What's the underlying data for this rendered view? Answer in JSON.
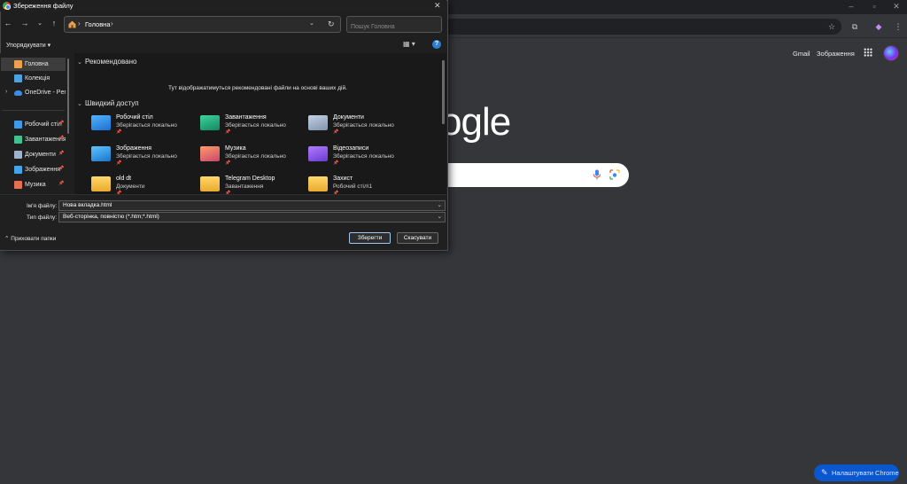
{
  "dialog": {
    "title": "Збереження файлу",
    "address": {
      "path": "Головна"
    },
    "search_placeholder": "Пошук Головна",
    "organize_label": "Упорядкувати ▾",
    "help_label": "?",
    "nav": [
      {
        "label": "Головна",
        "icon": "home-icon",
        "color": "#f0a04b"
      },
      {
        "label": "Колекція",
        "icon": "gallery-icon",
        "color": "#4aa3df"
      },
      {
        "label": "OneDrive - Pers",
        "icon": "cloud-icon",
        "color": "#3c8ce7"
      },
      {
        "label": "Робочий стіл",
        "icon": "desktop-icon",
        "color": "#3d9ae8"
      },
      {
        "label": "Завантаження",
        "icon": "download-icon",
        "color": "#3ec28f"
      },
      {
        "label": "Документи",
        "icon": "documents-icon",
        "color": "#9fb3cc"
      },
      {
        "label": "Зображення",
        "icon": "pictures-icon",
        "color": "#41a5ee"
      },
      {
        "label": "Музика",
        "icon": "music-icon",
        "color": "#e76f51"
      }
    ],
    "sections": {
      "recommended": "Рекомендовано",
      "recommended_empty": "Тут відображатимуться рекомендовані файли на основі ваших дій.",
      "quick_access": "Швидкий доступ"
    },
    "quick_access": [
      {
        "name": "Робочий стіл",
        "sub": "Зберігається локально",
        "icon": "desktop-folder-icon"
      },
      {
        "name": "Завантаження",
        "sub": "Зберігається локально",
        "icon": "downloads-folder-icon"
      },
      {
        "name": "Документи",
        "sub": "Зберігається локально",
        "icon": "documents-folder-icon"
      },
      {
        "name": "Зображення",
        "sub": "Зберігається локально",
        "icon": "pictures-folder-icon"
      },
      {
        "name": "Музика",
        "sub": "Зберігається локально",
        "icon": "music-folder-icon"
      },
      {
        "name": "Відеозаписи",
        "sub": "Зберігається локально",
        "icon": "videos-folder-icon"
      },
      {
        "name": "old dt",
        "sub": "Документи",
        "icon": "folder-icon"
      },
      {
        "name": "Telegram Desktop",
        "sub": "Завантаження",
        "icon": "folder-icon"
      },
      {
        "name": "Захист",
        "sub": "Робочий стіл\\1",
        "icon": "folder-icon"
      }
    ],
    "filename_label": "Ім'я файлу:",
    "filename_value": "Нова вкладка.html",
    "filetype_label": "Тип файлу:",
    "filetype_value": "Веб-сторінка, повністю (*.htm;*.html)",
    "hide_folders_label": "Приховати папки",
    "save_label": "Зберегти",
    "cancel_label": "Скасувати"
  },
  "chrome": {
    "gmail": "Gmail",
    "images": "Зображення",
    "logo_fragment": "ogle",
    "customize": "Налаштувати Chrome"
  }
}
